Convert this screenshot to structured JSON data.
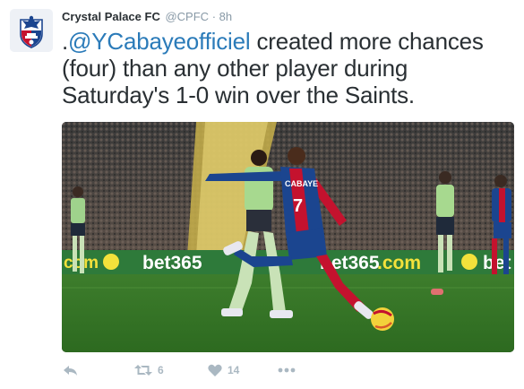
{
  "tweet": {
    "author_name": "Crystal Palace FC",
    "handle": "@CPFC",
    "separator": "·",
    "time": "8h",
    "text_prefix": ".",
    "mention": "@YCabayeofficiel",
    "text_body": " created more chances (four) than any other player during Saturday's 1-0 win over the Saints."
  },
  "media": {
    "ad_board_left": "com",
    "ad_board_bet": "bet365",
    "ad_board_bet2": "bet365",
    "ad_board_com": ".com",
    "ad_board_right": "bet",
    "player_shirt_name": "CABAYE",
    "player_shirt_number": "7"
  },
  "actions": {
    "reply_icon": "reply-icon",
    "retweet_icon": "retweet-icon",
    "retweet_count": "6",
    "like_icon": "heart-icon",
    "like_count": "14",
    "more_icon": "more-icon"
  },
  "colors": {
    "mention": "#2b7bb9",
    "muted": "#8899a6",
    "action_icons": "#aab8c2",
    "text": "#292f33"
  }
}
